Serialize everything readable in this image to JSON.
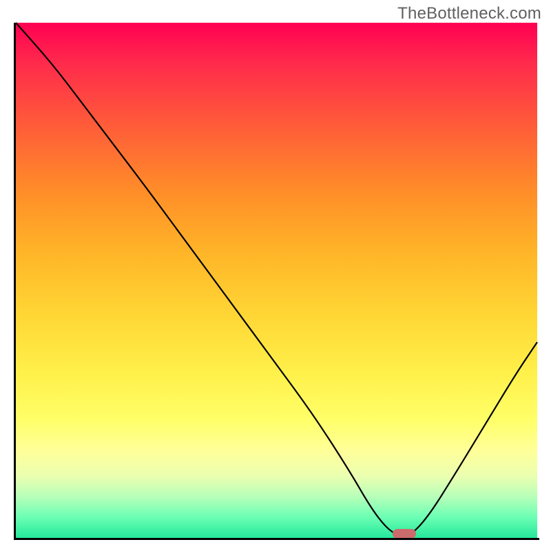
{
  "attribution": "TheBottleneck.com",
  "chart_data": {
    "type": "line",
    "title": "",
    "xlabel": "",
    "ylabel": "",
    "xlim": [
      0,
      100
    ],
    "ylim": [
      0,
      100
    ],
    "x": [
      0,
      7,
      13,
      19,
      25,
      33,
      41,
      49,
      57,
      64,
      68,
      71,
      73.5,
      75.5,
      79,
      84,
      90,
      96,
      100
    ],
    "values": [
      100,
      92,
      84,
      76,
      68,
      57,
      46,
      35,
      24,
      13,
      6,
      2,
      0.3,
      0.3,
      4,
      12,
      22,
      32,
      38
    ],
    "marker": {
      "x": 74.5,
      "y": 0.8
    },
    "background_gradient": {
      "top": "#ff0052",
      "bottom": "#24e89a",
      "stops": [
        "red",
        "orange",
        "yellow",
        "green"
      ]
    }
  }
}
